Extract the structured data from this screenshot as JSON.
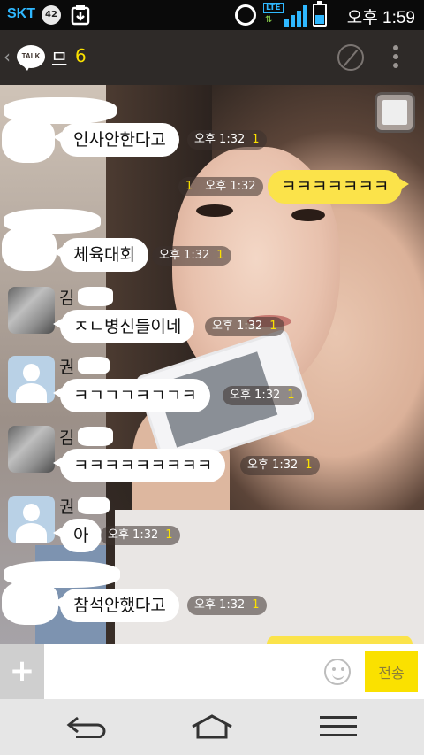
{
  "status_bar": {
    "carrier": "SKT",
    "badge": "42",
    "time": "오후 1:59",
    "network": "LTE"
  },
  "header": {
    "title": "므",
    "member_count": "6"
  },
  "messages": [
    {
      "direction": "in",
      "text": "인사안한다고",
      "time": "오후 1:32",
      "unread": "1"
    },
    {
      "direction": "out",
      "text": "ㅋㅋㅋㅋㅋㅋㅋ",
      "time": "오후 1:32",
      "unread": "1"
    },
    {
      "direction": "in",
      "text": "체육대회",
      "time": "오후 1:32",
      "unread": "1"
    },
    {
      "direction": "in",
      "sender": "김",
      "text": "ㅈㄴ병신들이네",
      "time": "오후 1:32",
      "unread": "1"
    },
    {
      "direction": "in",
      "sender": "권",
      "text": "ㅋㄱㄱㄱㅋㄱㄱㅋ",
      "time": "오후 1:32",
      "unread": "1"
    },
    {
      "direction": "in",
      "sender": "김",
      "text": "ㅋㅋㅋㅋㅋㅋㅋㅋㅋ",
      "time": "오후 1:32",
      "unread": "1"
    },
    {
      "direction": "in",
      "sender": "권",
      "text": "아",
      "time": "오후 1:32",
      "unread": "1"
    },
    {
      "direction": "in",
      "text": "참석안했다고",
      "time": "오후 1:32",
      "unread": "1"
    }
  ],
  "input": {
    "plus": "+",
    "value": "",
    "send_label": "전송"
  },
  "colors": {
    "accent_yellow": "#fae100",
    "header_bg": "#2e2a28",
    "carrier_blue": "#2fb8ff"
  }
}
